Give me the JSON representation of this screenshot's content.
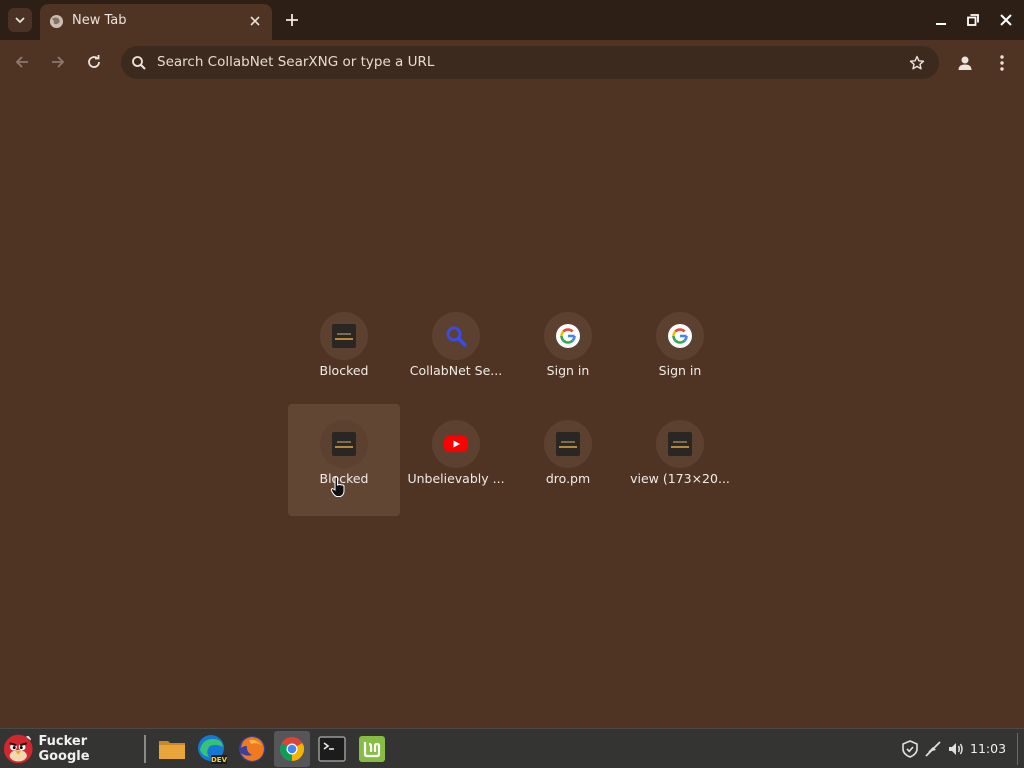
{
  "browser": {
    "tab": {
      "title": "New Tab"
    },
    "omnibox": {
      "placeholder": "Search CollabNet SearXNG or type a URL"
    }
  },
  "shortcuts": [
    {
      "label": "Blocked",
      "icon": "blocked-image-icon"
    },
    {
      "label": "CollabNet Se...",
      "icon": "magnifier-icon"
    },
    {
      "label": "Sign in",
      "icon": "google-icon"
    },
    {
      "label": "Sign in",
      "icon": "google-icon"
    },
    {
      "label": "Blocked",
      "icon": "blocked-image-icon",
      "hovered": true
    },
    {
      "label": "Unbelievably ...",
      "icon": "youtube-icon"
    },
    {
      "label": "dro.pm",
      "icon": "blocked-image-icon"
    },
    {
      "label": "view (173×20...",
      "icon": "blocked-image-icon"
    }
  ],
  "taskbar": {
    "start_label": "Fucker Google",
    "apps": [
      "files-icon",
      "edge-dev-icon",
      "firefox-icon",
      "chrome-icon",
      "terminal-icon",
      "mint-icon"
    ],
    "clock": "11:03"
  },
  "colors": {
    "page_bg": "#4f3424",
    "tabstrip_bg": "#2e1f16",
    "taskbar_bg": "#343432"
  }
}
